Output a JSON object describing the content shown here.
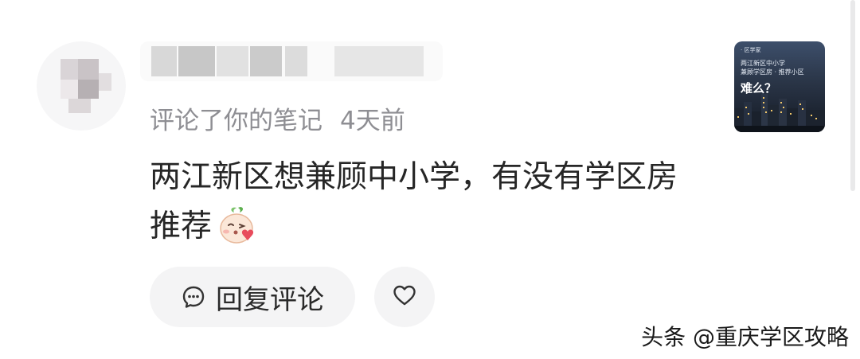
{
  "comment_card": {
    "meta_action": "评论了你的笔记",
    "meta_time": "4天前",
    "comment_text": "两江新区想兼顾中小学，有没有学区房推荐",
    "emoji_name": "blowing-kiss-peach-emoji"
  },
  "actions": {
    "reply_label": "回复评论",
    "reply_icon": "comment-bubble-icon",
    "like_icon": "heart-outline-icon"
  },
  "thumbnail": {
    "small_text": "· 区学家",
    "line1": "两江新区中小学",
    "line2": "兼顾学区房 · 推荐小区",
    "title": "难么？"
  },
  "watermark": {
    "text": "头条 @重庆学区攻略"
  },
  "colors": {
    "text_primary": "#262626",
    "text_secondary": "#8e8e93",
    "button_bg": "#f4f4f5"
  }
}
